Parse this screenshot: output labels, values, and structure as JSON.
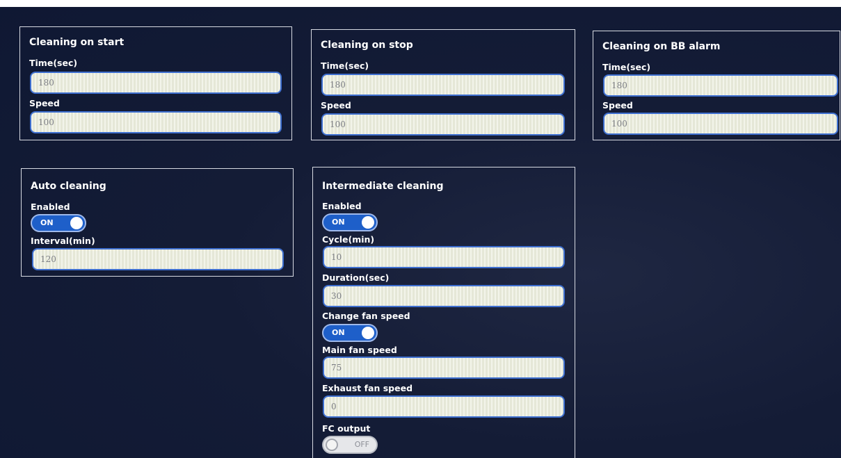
{
  "panels": {
    "start": {
      "title": "Cleaning on start",
      "time_label": "Time(sec)",
      "time_value": "180",
      "speed_label": "Speed",
      "speed_value": "100"
    },
    "stop": {
      "title": "Cleaning on stop",
      "time_label": "Time(sec)",
      "time_value": "180",
      "speed_label": "Speed",
      "speed_value": "100"
    },
    "bb_alarm": {
      "title": "Cleaning on BB alarm",
      "time_label": "Time(sec)",
      "time_value": "180",
      "speed_label": "Speed",
      "speed_value": "100"
    },
    "auto": {
      "title": "Auto cleaning",
      "enabled_label": "Enabled",
      "enabled_state": "ON",
      "interval_label": "Interval(min)",
      "interval_value": "120"
    },
    "intermediate": {
      "title": "Intermediate cleaning",
      "enabled_label": "Enabled",
      "enabled_state": "ON",
      "cycle_label": "Cycle(min)",
      "cycle_value": "10",
      "duration_label": "Duration(sec)",
      "duration_value": "30",
      "change_fan_label": "Change fan speed",
      "change_fan_state": "ON",
      "main_fan_label": "Main fan speed",
      "main_fan_value": "75",
      "exhaust_fan_label": "Exhaust fan speed",
      "exhaust_fan_value": "0",
      "fc_output_label": "FC output",
      "fc_output_state": "OFF"
    }
  },
  "colors": {
    "background": "#111a35",
    "panel_border": "#d8dbe3",
    "toggle_on": "#1e5fc9",
    "input_border": "#3e6fd0"
  }
}
